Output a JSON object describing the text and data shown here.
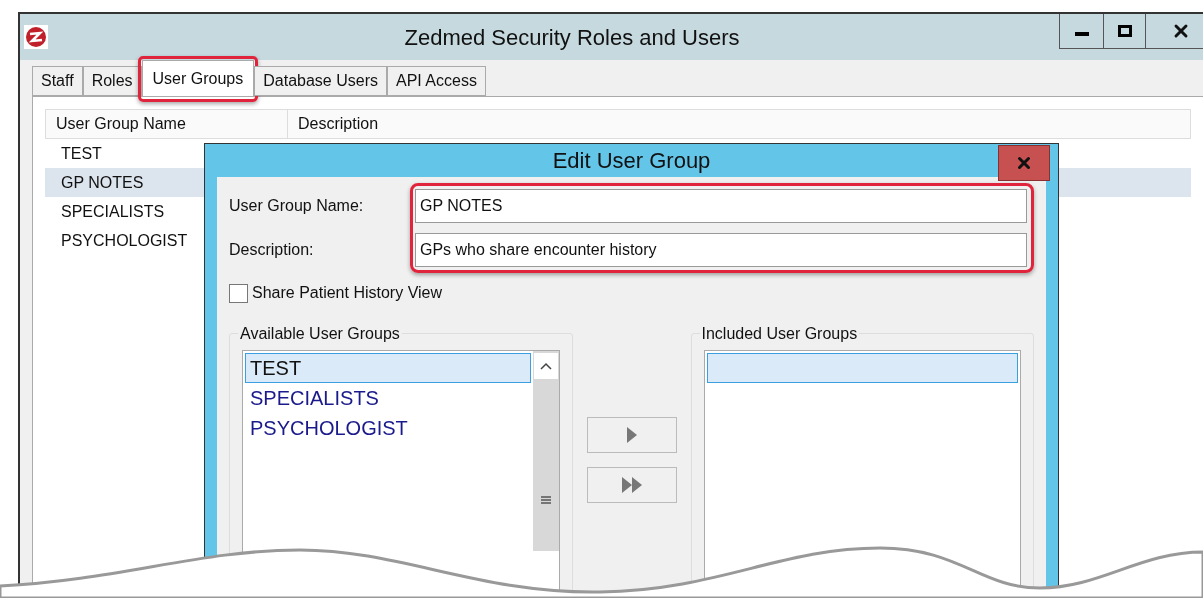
{
  "window": {
    "title": "Zedmed Security Roles and Users"
  },
  "tabs": [
    {
      "label": "Staff",
      "selected": false,
      "highlighted": false
    },
    {
      "label": "Roles",
      "selected": false,
      "highlighted": false
    },
    {
      "label": "User Groups",
      "selected": true,
      "highlighted": true
    },
    {
      "label": "Database Users",
      "selected": false,
      "highlighted": false
    },
    {
      "label": "API Access",
      "selected": false,
      "highlighted": false
    }
  ],
  "table": {
    "columns": [
      "User Group Name",
      "Description"
    ],
    "rows": [
      {
        "name": "TEST",
        "selected": false
      },
      {
        "name": "GP NOTES",
        "selected": true
      },
      {
        "name": "SPECIALISTS",
        "selected": false
      },
      {
        "name": "PSYCHOLOGIST",
        "selected": false
      }
    ]
  },
  "dialog": {
    "title": "Edit User Group",
    "fields_highlighted": true,
    "fields": [
      {
        "label": "User Group Name:",
        "value": "GP NOTES"
      },
      {
        "label": "Description:",
        "value": "GPs who share encounter history"
      }
    ],
    "checkbox": {
      "label": "Share Patient History View",
      "checked": false
    },
    "available": {
      "title": "Available User Groups",
      "items": [
        {
          "label": "TEST",
          "selected": true
        },
        {
          "label": "SPECIALISTS",
          "selected": false
        },
        {
          "label": "PSYCHOLOGIST",
          "selected": false
        }
      ]
    },
    "included": {
      "title": "Included User Groups"
    }
  }
}
